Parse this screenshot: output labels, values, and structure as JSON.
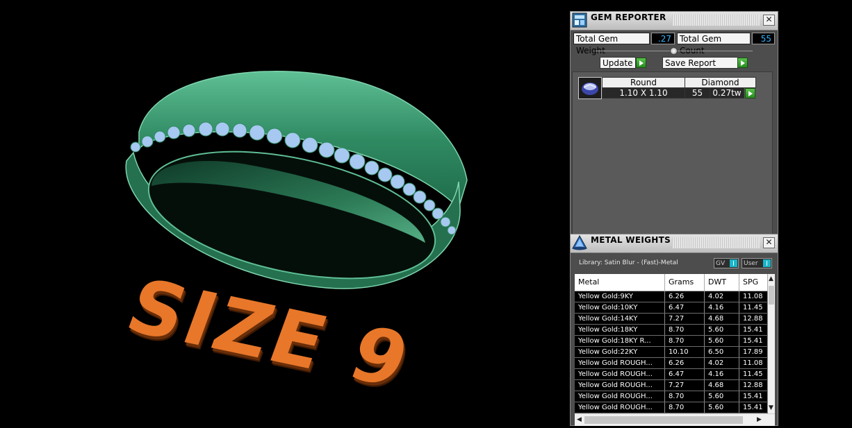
{
  "viewport": {
    "overlay_text": "SIZE 9",
    "colors": {
      "ring": "#2f8a62",
      "gems": "#a7c8f0",
      "text": "#e8772a"
    }
  },
  "gem_reporter": {
    "title": "GEM REPORTER",
    "close_icon": "close-icon",
    "total_weight_label": "Total Gem Weight",
    "total_weight_value": ".27",
    "total_count_label": "Total Gem Count",
    "total_count_value": "55",
    "update_label": "Update",
    "save_report_label": "Save Report",
    "gem": {
      "shape": "Round",
      "type": "Diamond",
      "size": "1.10 X 1.10",
      "count": "55",
      "weight": "0.27tw"
    }
  },
  "metal_weights": {
    "title": "METAL WEIGHTS",
    "library_label": "Library: Satin Blur - (Fast)-Metal",
    "gv_label": "GV",
    "user_label": "User",
    "columns": [
      "Metal",
      "Grams",
      "DWT",
      "SPG"
    ],
    "rows": [
      [
        "Yellow Gold:9KY",
        "6.26",
        "4.02",
        "11.08"
      ],
      [
        "Yellow Gold:10KY",
        "6.47",
        "4.16",
        "11.45"
      ],
      [
        "Yellow Gold:14KY",
        "7.27",
        "4.68",
        "12.88"
      ],
      [
        "Yellow Gold:18KY",
        "8.70",
        "5.60",
        "15.41"
      ],
      [
        "Yellow Gold:18KY R...",
        "8.70",
        "5.60",
        "15.41"
      ],
      [
        "Yellow Gold:22KY",
        "10.10",
        "6.50",
        "17.89"
      ],
      [
        "Yellow Gold ROUGH...",
        "6.26",
        "4.02",
        "11.08"
      ],
      [
        "Yellow Gold ROUGH...",
        "6.47",
        "4.16",
        "11.45"
      ],
      [
        "Yellow Gold ROUGH...",
        "7.27",
        "4.68",
        "12.88"
      ],
      [
        "Yellow Gold ROUGH...",
        "8.70",
        "5.60",
        "15.41"
      ],
      [
        "Yellow Gold ROUGH...",
        "8.70",
        "5.60",
        "15.41"
      ]
    ]
  }
}
